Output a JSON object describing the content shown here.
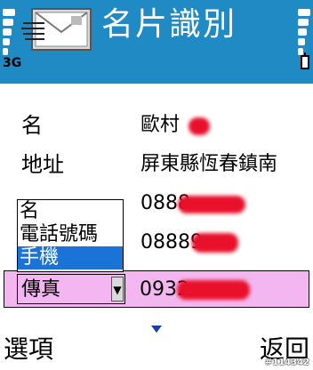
{
  "status": {
    "network": "3G"
  },
  "header": {
    "title": "名片識別",
    "app_icon": "business-card-scan-icon"
  },
  "fields": {
    "name": {
      "label": "名",
      "value": "歐村"
    },
    "address": {
      "label": "地址",
      "value": "屏東縣恆春鎮南"
    },
    "phone1": {
      "value": "0888"
    },
    "phone2": {
      "value": "08889"
    },
    "fax": {
      "selected": "傳真",
      "value": "0932"
    }
  },
  "dropdown": {
    "options": [
      "名",
      "電話號碼",
      "手機"
    ],
    "selected_index": 2
  },
  "softkeys": {
    "left": "選項",
    "right": "返回"
  },
  "watermark": "#114342",
  "colors": {
    "titlebar": "#1f8ac4",
    "selection": "#1a73d6",
    "highlight_row": "#f4b6f0",
    "redaction": "#e8102a"
  }
}
